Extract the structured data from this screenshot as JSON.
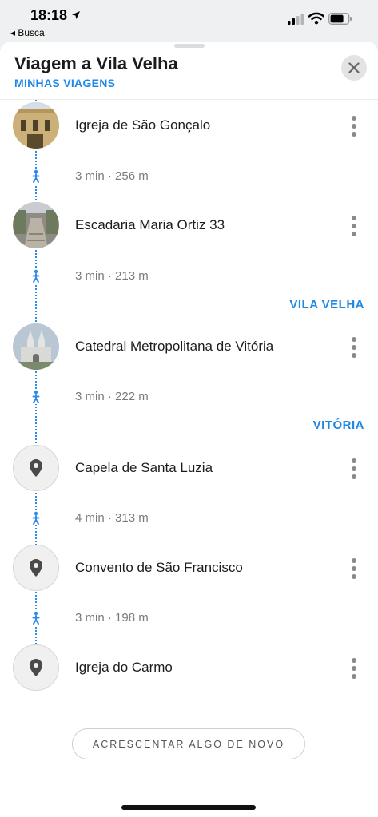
{
  "status_bar": {
    "time": "18:18",
    "back_app": "◂ Busca"
  },
  "header": {
    "title": "Viagem a Vila Velha",
    "subtitle": "MINHAS VIAGENS"
  },
  "stops": [
    {
      "name": "Igreja de São Gonçalo",
      "icon": "photo-thumbnail"
    },
    {
      "name": "Escadaria Maria Ortiz 33",
      "icon": "photo-thumbnail"
    },
    {
      "name": "Catedral Metropolitana de Vitória",
      "icon": "photo-thumbnail"
    },
    {
      "name": "Capela de Santa Luzia",
      "icon": "map-pin-icon"
    },
    {
      "name": "Convento de São Francisco",
      "icon": "map-pin-icon"
    },
    {
      "name": "Igreja do Carmo",
      "icon": "map-pin-icon"
    }
  ],
  "walks": [
    {
      "text": "3 min · 256 m"
    },
    {
      "text": "3 min · 213 m"
    },
    {
      "text": "3 min · 222 m"
    },
    {
      "text": "4 min · 313 m"
    },
    {
      "text": "3 min · 198 m"
    }
  ],
  "city_labels": [
    "VILA VELHA",
    "VITÓRIA"
  ],
  "add_button": "ACRESCENTAR ALGO DE NOVO",
  "colors": {
    "accent": "#1e88e5",
    "route": "#2f8bea"
  }
}
